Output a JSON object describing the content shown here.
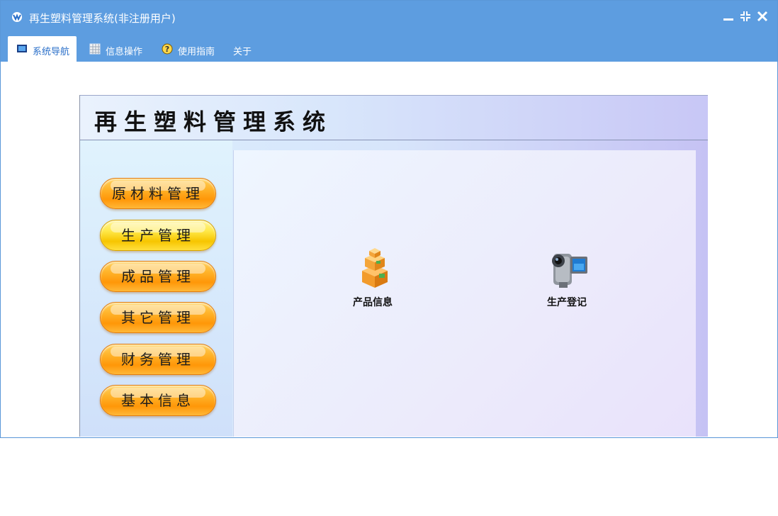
{
  "window": {
    "title": "再生塑料管理系统(非注册用户)"
  },
  "menu": {
    "tabs": [
      {
        "label": "系统导航",
        "icon": "monitor-icon"
      },
      {
        "label": "信息操作",
        "icon": "grid-icon"
      },
      {
        "label": "使用指南",
        "icon": "help-icon"
      },
      {
        "label": "关于",
        "icon": ""
      }
    ]
  },
  "banner": {
    "title": "再生塑料管理系统"
  },
  "sidebar": {
    "items": [
      {
        "label": "原材料管理"
      },
      {
        "label": "生产管理"
      },
      {
        "label": "成品管理"
      },
      {
        "label": "其它管理"
      },
      {
        "label": "财务管理"
      },
      {
        "label": "基本信息"
      }
    ]
  },
  "workspace": {
    "items": [
      {
        "label": "产品信息",
        "icon": "boxes-icon"
      },
      {
        "label": "生产登记",
        "icon": "video-camera-icon"
      }
    ]
  },
  "colors": {
    "titlebar": "#5d9de0",
    "button_orange": "#ff9708",
    "button_selected": "#ffe94a"
  }
}
